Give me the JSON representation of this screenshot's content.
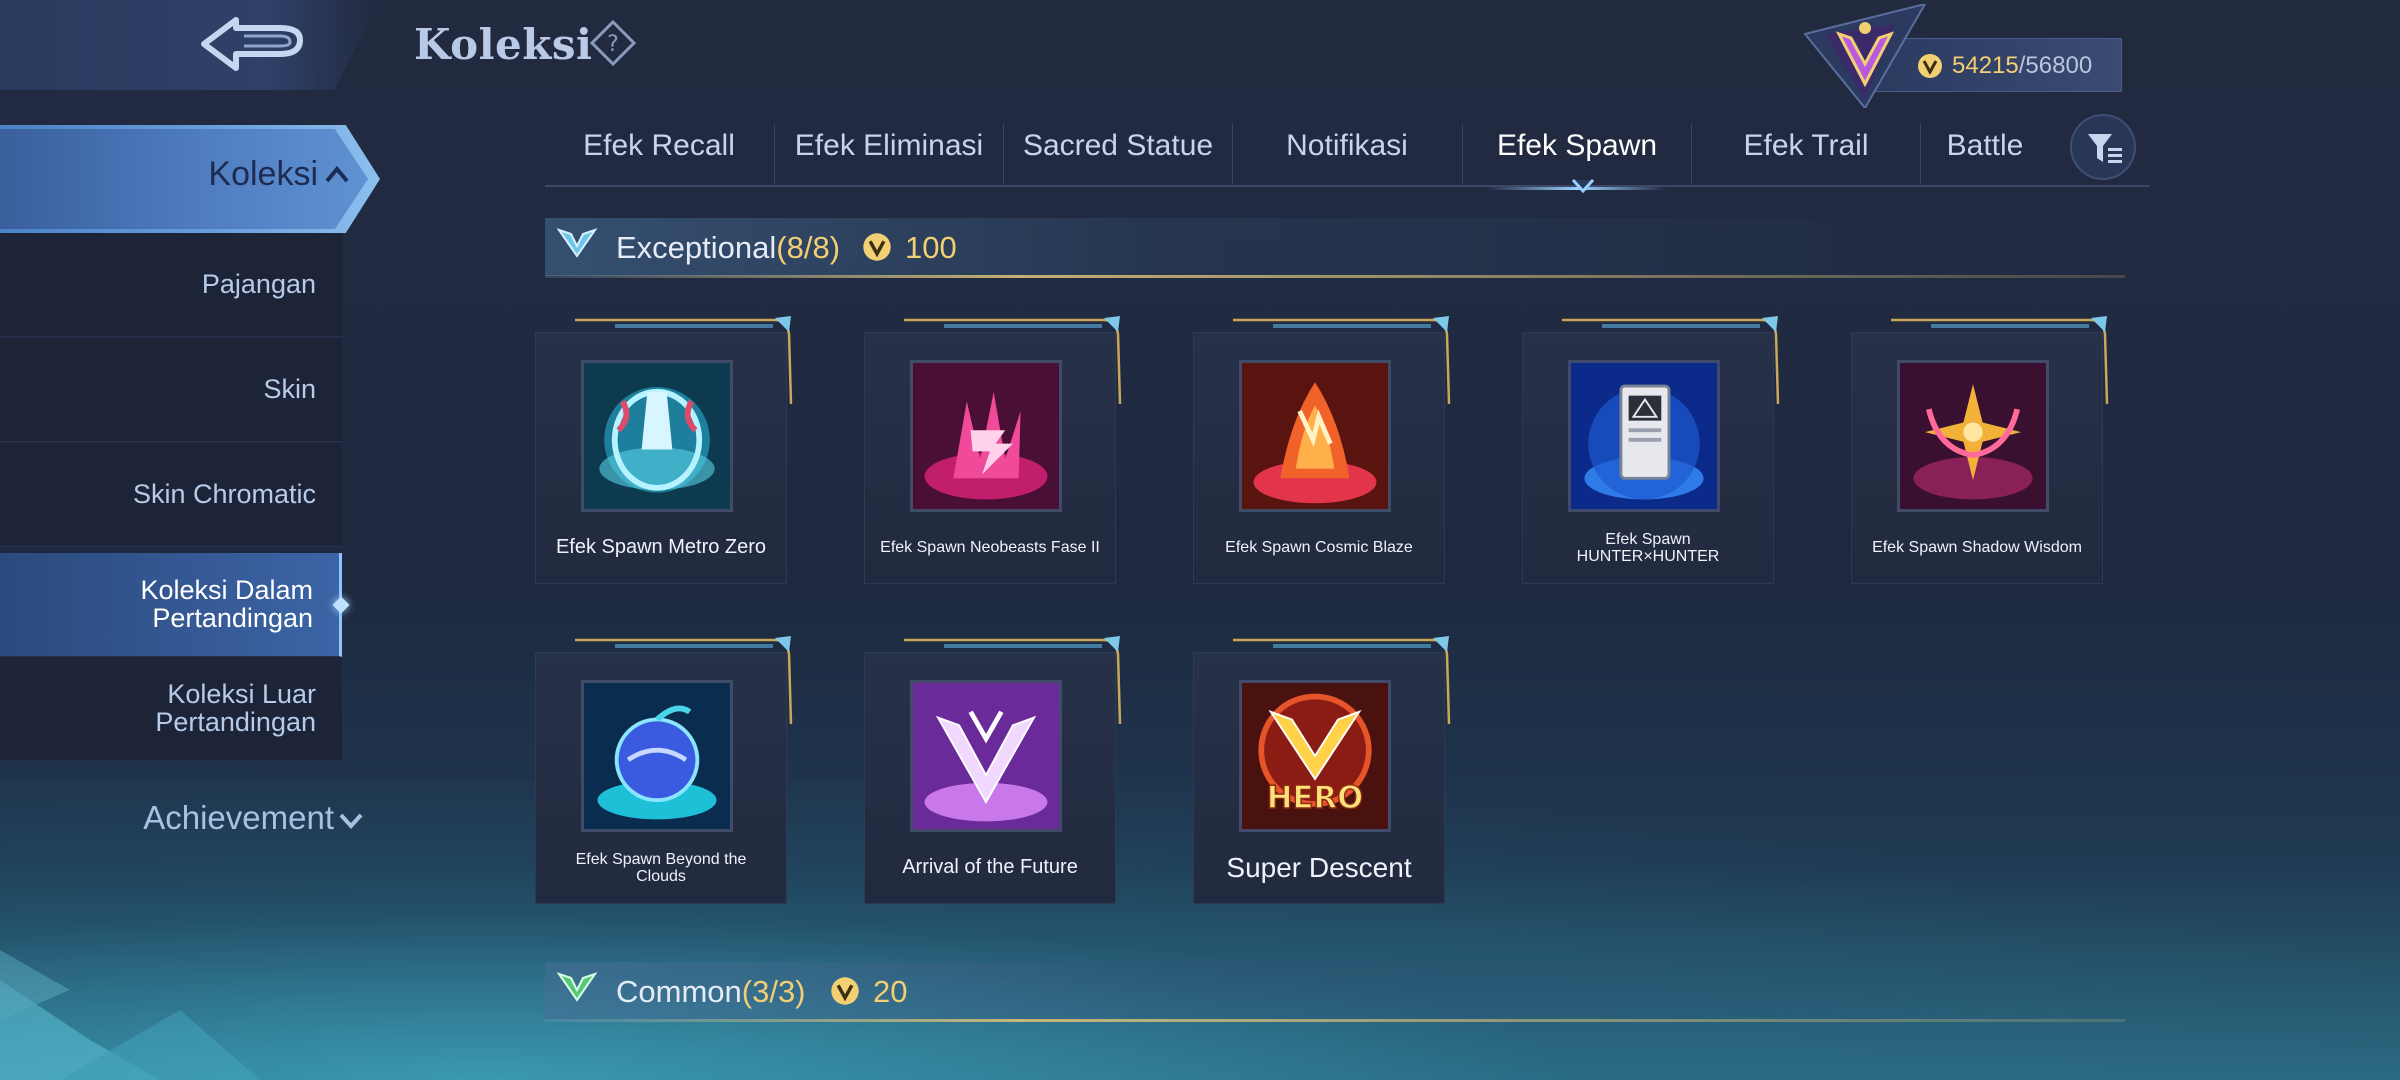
{
  "header": {
    "title": "Koleksi"
  },
  "currency": {
    "current": "54215",
    "separator": "/",
    "max": "56800"
  },
  "sidebar": {
    "header_label": "Koleksi",
    "items": [
      {
        "label": "Pajangan"
      },
      {
        "label": "Skin"
      },
      {
        "label": "Skin Chromatic"
      },
      {
        "label": "Koleksi Dalam\nPertandingan",
        "active": true
      },
      {
        "label": "Koleksi Luar\nPertandingan"
      }
    ],
    "achievement_label": "Achievement"
  },
  "tabs": [
    {
      "label": "Efek Recall"
    },
    {
      "label": "Efek Eliminasi"
    },
    {
      "label": "Sacred Statue"
    },
    {
      "label": "Notifikasi"
    },
    {
      "label": "Efek Spawn",
      "active": true
    },
    {
      "label": "Efek Trail"
    },
    {
      "label": "Battle"
    }
  ],
  "sections": [
    {
      "title": "Exceptional",
      "count": "(8/8)",
      "price": "100",
      "items": [
        {
          "name": "Efek Spawn Metro Zero",
          "art": "metro-zero-art"
        },
        {
          "name": "Efek Spawn Neobeasts Fase II",
          "art": "neobeasts-art"
        },
        {
          "name": "Efek Spawn Cosmic Blaze",
          "art": "cosmic-blaze-art"
        },
        {
          "name": "Efek Spawn\nHUNTER×HUNTER",
          "art": "hunter-hunter-art"
        },
        {
          "name": "Efek Spawn Shadow Wisdom",
          "art": "shadow-wisdom-art"
        },
        {
          "name": "Efek Spawn Beyond the\nClouds",
          "art": "beyond-clouds-art"
        },
        {
          "name": "Arrival of the Future",
          "art": "arrival-future-art"
        },
        {
          "name": "Super Descent",
          "art": "super-descent-art",
          "art_text": "HERO"
        }
      ]
    },
    {
      "title": "Common",
      "count": "(3/3)",
      "price": "20"
    }
  ],
  "colors": {
    "gold": "#f2cf72",
    "accent_blue": "#4f7dc0",
    "panel": "#1d2438"
  }
}
